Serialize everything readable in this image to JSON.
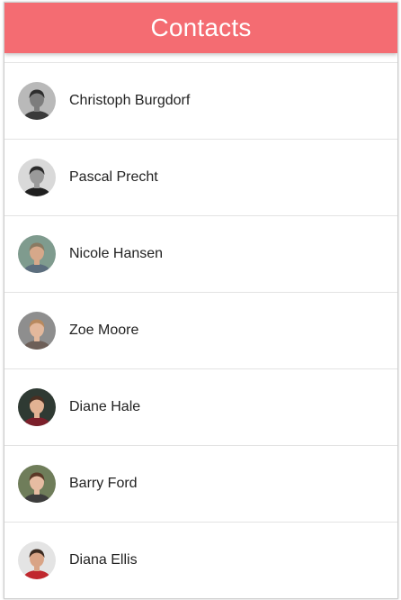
{
  "header": {
    "title": "Contacts",
    "color": "#f46c72"
  },
  "contacts": [
    {
      "name": "Christoph Burgdorf",
      "avatar": {
        "bg": "#b9b9b9",
        "skin": "#7d7d7d",
        "hair": "#2d2d2d",
        "shirt": "#3a3a3a"
      }
    },
    {
      "name": "Pascal Precht",
      "avatar": {
        "bg": "#d9d9d9",
        "skin": "#9a9a9a",
        "hair": "#2a2a2a",
        "shirt": "#1f1f1f"
      }
    },
    {
      "name": "Nicole Hansen",
      "avatar": {
        "bg": "#7f9b8e",
        "skin": "#d6a88a",
        "hair": "#8a7a62",
        "shirt": "#5c6e7e"
      }
    },
    {
      "name": "Zoe Moore",
      "avatar": {
        "bg": "#8e8e8e",
        "skin": "#e3b89c",
        "hair": "#b8895e",
        "shirt": "#6d5f58"
      }
    },
    {
      "name": "Diane Hale",
      "avatar": {
        "bg": "#2f3a33",
        "skin": "#e2b293",
        "hair": "#4a2f22",
        "shirt": "#7b1f2a"
      }
    },
    {
      "name": "Barry Ford",
      "avatar": {
        "bg": "#6f7d5a",
        "skin": "#e6bca2",
        "hair": "#5b3826",
        "shirt": "#3d3d3d"
      }
    },
    {
      "name": "Diana Ellis",
      "avatar": {
        "bg": "#e4e4e4",
        "skin": "#d9a486",
        "hair": "#3b2a20",
        "shirt": "#c0282e"
      }
    }
  ]
}
